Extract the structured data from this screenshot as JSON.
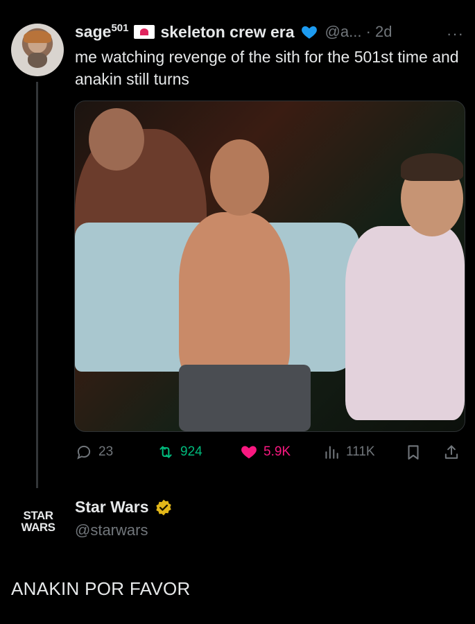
{
  "tweet": {
    "display_name": "sage",
    "display_name_sup": "501",
    "display_name_suffix": "skeleton crew era",
    "handle": "@a...",
    "separator": "·",
    "time": "2d",
    "more_label": "···",
    "text": "me watching revenge of the sith for the 501st time and anakin still turns",
    "stats": {
      "replies": "23",
      "retweets": "924",
      "likes": "5.9K",
      "views": "111K"
    },
    "colors": {
      "retweet": "#00ba7c",
      "like": "#f91880",
      "verified_blue": "#1d9bf0"
    },
    "icons": [
      "reply-icon",
      "retweet-icon",
      "heart-icon",
      "views-icon",
      "bookmark-icon",
      "share-icon",
      "blue-heart-icon",
      "envelope-heart-icon"
    ]
  },
  "reply": {
    "display_name": "Star Wars",
    "handle": "@starwars",
    "text": "ANAKIN POR FAVOR",
    "logo_text_line1": "STAR",
    "logo_text_line2": "WARS",
    "colors": {
      "verified_gold": "#e2b719"
    },
    "icons": [
      "verified-gold-icon",
      "star-wars-logo"
    ]
  }
}
